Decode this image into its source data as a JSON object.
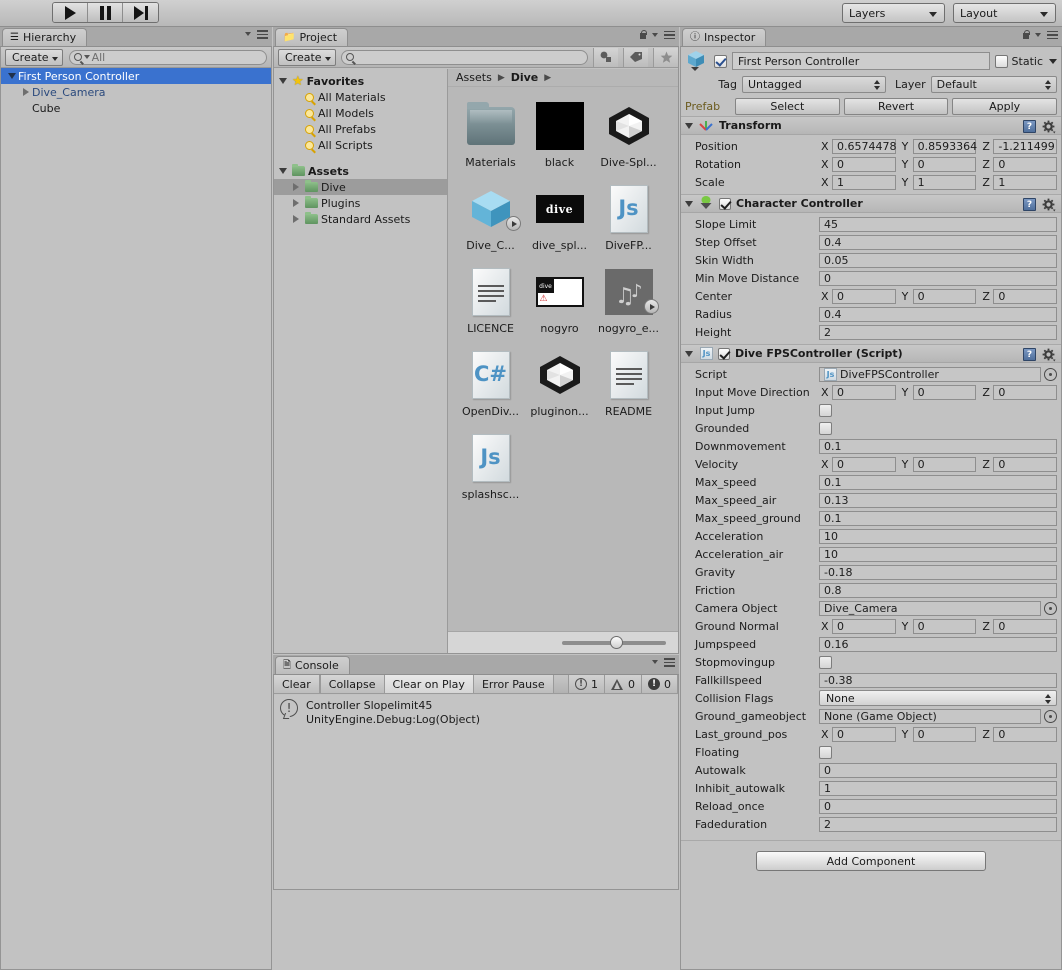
{
  "toolbar": {
    "play_icon": "play-icon",
    "pause_icon": "pause-icon",
    "step_icon": "step-icon",
    "layers_label": "Layers",
    "layout_label": "Layout"
  },
  "hierarchy": {
    "tab_label": "Hierarchy",
    "tab_icon": "hierarchy-icon",
    "create_label": "Create",
    "search_placeholder": "All",
    "items": [
      {
        "label": "First Person Controller",
        "indent": 0,
        "twisty": "down",
        "selected": true,
        "prefab": false
      },
      {
        "label": "Dive_Camera",
        "indent": 1,
        "twisty": "right",
        "selected": false,
        "prefab": true
      },
      {
        "label": "Cube",
        "indent": 1,
        "twisty": "none",
        "selected": false,
        "prefab": false
      }
    ]
  },
  "project": {
    "tab_label": "Project",
    "tab_icon": "folder-icon",
    "create_label": "Create",
    "search_placeholder": "",
    "toolbar_icons": [
      "asset-filter-icon",
      "label-filter-icon",
      "favorite-star-icon"
    ],
    "tree": [
      {
        "label": "Favorites",
        "kind": "favorites-root",
        "twisty": "down",
        "bold": true,
        "indent": 0
      },
      {
        "label": "All Materials",
        "kind": "saved-search",
        "twisty": "none",
        "bold": false,
        "indent": 1
      },
      {
        "label": "All Models",
        "kind": "saved-search",
        "twisty": "none",
        "bold": false,
        "indent": 1
      },
      {
        "label": "All Prefabs",
        "kind": "saved-search",
        "twisty": "none",
        "bold": false,
        "indent": 1
      },
      {
        "label": "All Scripts",
        "kind": "saved-search",
        "twisty": "none",
        "bold": false,
        "indent": 1
      },
      {
        "label": "",
        "kind": "spacer",
        "twisty": "none",
        "bold": false,
        "indent": 0
      },
      {
        "label": "Assets",
        "kind": "folder-green",
        "twisty": "down",
        "bold": true,
        "indent": 0
      },
      {
        "label": "Dive",
        "kind": "folder-green",
        "twisty": "right",
        "bold": false,
        "indent": 1,
        "selected": true
      },
      {
        "label": "Plugins",
        "kind": "folder-green",
        "twisty": "right",
        "bold": false,
        "indent": 1
      },
      {
        "label": "Standard Assets",
        "kind": "folder-green",
        "twisty": "right",
        "bold": false,
        "indent": 1
      }
    ],
    "breadcrumb": [
      "Assets",
      "Dive"
    ],
    "assets": [
      {
        "name": "Materials",
        "thumb": "folder-thumb"
      },
      {
        "name": "black",
        "thumb": "black-texture-thumb"
      },
      {
        "name": "Dive-Spl...",
        "thumb": "unity-prefab-thumb"
      },
      {
        "name": "Dive_C...",
        "thumb": "cube-prefab-thumb",
        "badge": "preview-play-badge"
      },
      {
        "name": "dive_spl...",
        "thumb": "dive-logo-texture-thumb",
        "thumb_text": "dive"
      },
      {
        "name": "DiveFP...",
        "thumb": "js-script-thumb",
        "thumb_text": "Js"
      },
      {
        "name": "LICENCE",
        "thumb": "text-doc-thumb"
      },
      {
        "name": "nogyro",
        "thumb": "nogyro-image-thumb"
      },
      {
        "name": "nogyro_e...",
        "thumb": "nogyro-model-thumb",
        "badge": "preview-play-badge"
      },
      {
        "name": "OpenDiv...",
        "thumb": "csharp-script-thumb",
        "thumb_text": "C#"
      },
      {
        "name": "pluginon...",
        "thumb": "unity-prefab-thumb"
      },
      {
        "name": "README",
        "thumb": "text-doc-thumb"
      },
      {
        "name": "splashsc...",
        "thumb": "js-script-thumb",
        "thumb_text": "Js"
      }
    ],
    "zoom_slider_value": 48
  },
  "console": {
    "tab_label": "Console",
    "tab_icon": "console-icon",
    "buttons": [
      "Clear",
      "Collapse",
      "Clear on Play",
      "Error Pause"
    ],
    "counts": {
      "info": "1",
      "warning": "0",
      "error": "0"
    },
    "entries": [
      {
        "icon": "info-icon",
        "line1": "Controller Slopelimit45",
        "line2": "UnityEngine.Debug:Log(Object)"
      }
    ]
  },
  "inspector": {
    "tab_label": "Inspector",
    "tab_icon": "info-icon",
    "object_name": "First Person Controller",
    "object_enabled": true,
    "static_label": "Static",
    "static_checked": false,
    "tag_label": "Tag",
    "tag_value": "Untagged",
    "layer_label": "Layer",
    "layer_value": "Default",
    "prefab_label": "Prefab",
    "prefab_buttons": [
      "Select",
      "Revert",
      "Apply"
    ],
    "components": [
      {
        "title": "Transform",
        "icon": "transform-icon",
        "has_enable_checkbox": false,
        "fields": [
          {
            "label": "Position",
            "type": "vector3",
            "x": "0.6574478",
            "y": "0.8593364",
            "z": "-1.211499"
          },
          {
            "label": "Rotation",
            "type": "vector3",
            "x": "0",
            "y": "0",
            "z": "0"
          },
          {
            "label": "Scale",
            "type": "vector3",
            "x": "1",
            "y": "1",
            "z": "1"
          }
        ]
      },
      {
        "title": "Character Controller",
        "icon": "character-controller-icon",
        "has_enable_checkbox": true,
        "enabled": true,
        "fields": [
          {
            "label": "Slope Limit",
            "type": "text",
            "value": "45"
          },
          {
            "label": "Step Offset",
            "type": "text",
            "value": "0.4"
          },
          {
            "label": "Skin Width",
            "type": "text",
            "value": "0.05"
          },
          {
            "label": "Min Move Distance",
            "type": "text",
            "value": "0"
          },
          {
            "label": "Center",
            "type": "vector3",
            "x": "0",
            "y": "0",
            "z": "0"
          },
          {
            "label": "Radius",
            "type": "text",
            "value": "0.4"
          },
          {
            "label": "Height",
            "type": "text",
            "value": "2"
          }
        ]
      },
      {
        "title": "Dive FPSController (Script)",
        "icon": "js-script-icon",
        "has_enable_checkbox": true,
        "enabled": true,
        "fields": [
          {
            "label": "Script",
            "type": "object",
            "value": "DiveFPSController",
            "icon": "js-script-icon"
          },
          {
            "label": "Input Move Direction",
            "type": "vector3",
            "x": "0",
            "y": "0",
            "z": "0"
          },
          {
            "label": "Input Jump",
            "type": "checkbox",
            "checked": false
          },
          {
            "label": "Grounded",
            "type": "checkbox",
            "checked": false
          },
          {
            "label": "Downmovement",
            "type": "text",
            "value": "0.1"
          },
          {
            "label": "Velocity",
            "type": "vector3",
            "x": "0",
            "y": "0",
            "z": "0"
          },
          {
            "label": "Max_speed",
            "type": "text",
            "value": "0.1"
          },
          {
            "label": "Max_speed_air",
            "type": "text",
            "value": "0.13"
          },
          {
            "label": "Max_speed_ground",
            "type": "text",
            "value": "0.1"
          },
          {
            "label": "Acceleration",
            "type": "text",
            "value": "10"
          },
          {
            "label": "Acceleration_air",
            "type": "text",
            "value": "10"
          },
          {
            "label": "Gravity",
            "type": "text",
            "value": "-0.18"
          },
          {
            "label": "Friction",
            "type": "text",
            "value": "0.8"
          },
          {
            "label": "Camera Object",
            "type": "object",
            "value": "Dive_Camera"
          },
          {
            "label": "Ground Normal",
            "type": "vector3",
            "x": "0",
            "y": "0",
            "z": "0"
          },
          {
            "label": "Jumpspeed",
            "type": "text",
            "value": "0.16"
          },
          {
            "label": "Stopmovingup",
            "type": "checkbox",
            "checked": false
          },
          {
            "label": "Fallkillspeed",
            "type": "text",
            "value": "-0.38"
          },
          {
            "label": "Collision Flags",
            "type": "dropdown",
            "value": "None"
          },
          {
            "label": "Ground_gameobject",
            "type": "object",
            "value": "None (Game Object)"
          },
          {
            "label": "Last_ground_pos",
            "type": "vector3",
            "x": "0",
            "y": "0",
            "z": "0"
          },
          {
            "label": "Floating",
            "type": "checkbox",
            "checked": false
          },
          {
            "label": "Autowalk",
            "type": "text",
            "value": "0"
          },
          {
            "label": "Inhibit_autowalk",
            "type": "text",
            "value": "1"
          },
          {
            "label": "Reload_once",
            "type": "text",
            "value": "0"
          },
          {
            "label": "Fadeduration",
            "type": "text",
            "value": "2"
          }
        ]
      }
    ],
    "add_component_label": "Add Component"
  },
  "colors": {
    "selection_blue": "#3a72cf",
    "panel_bg": "#c2c2c2",
    "toolbar_bg": "#c8c8c8",
    "prefab_text": "#2b4a7d"
  }
}
